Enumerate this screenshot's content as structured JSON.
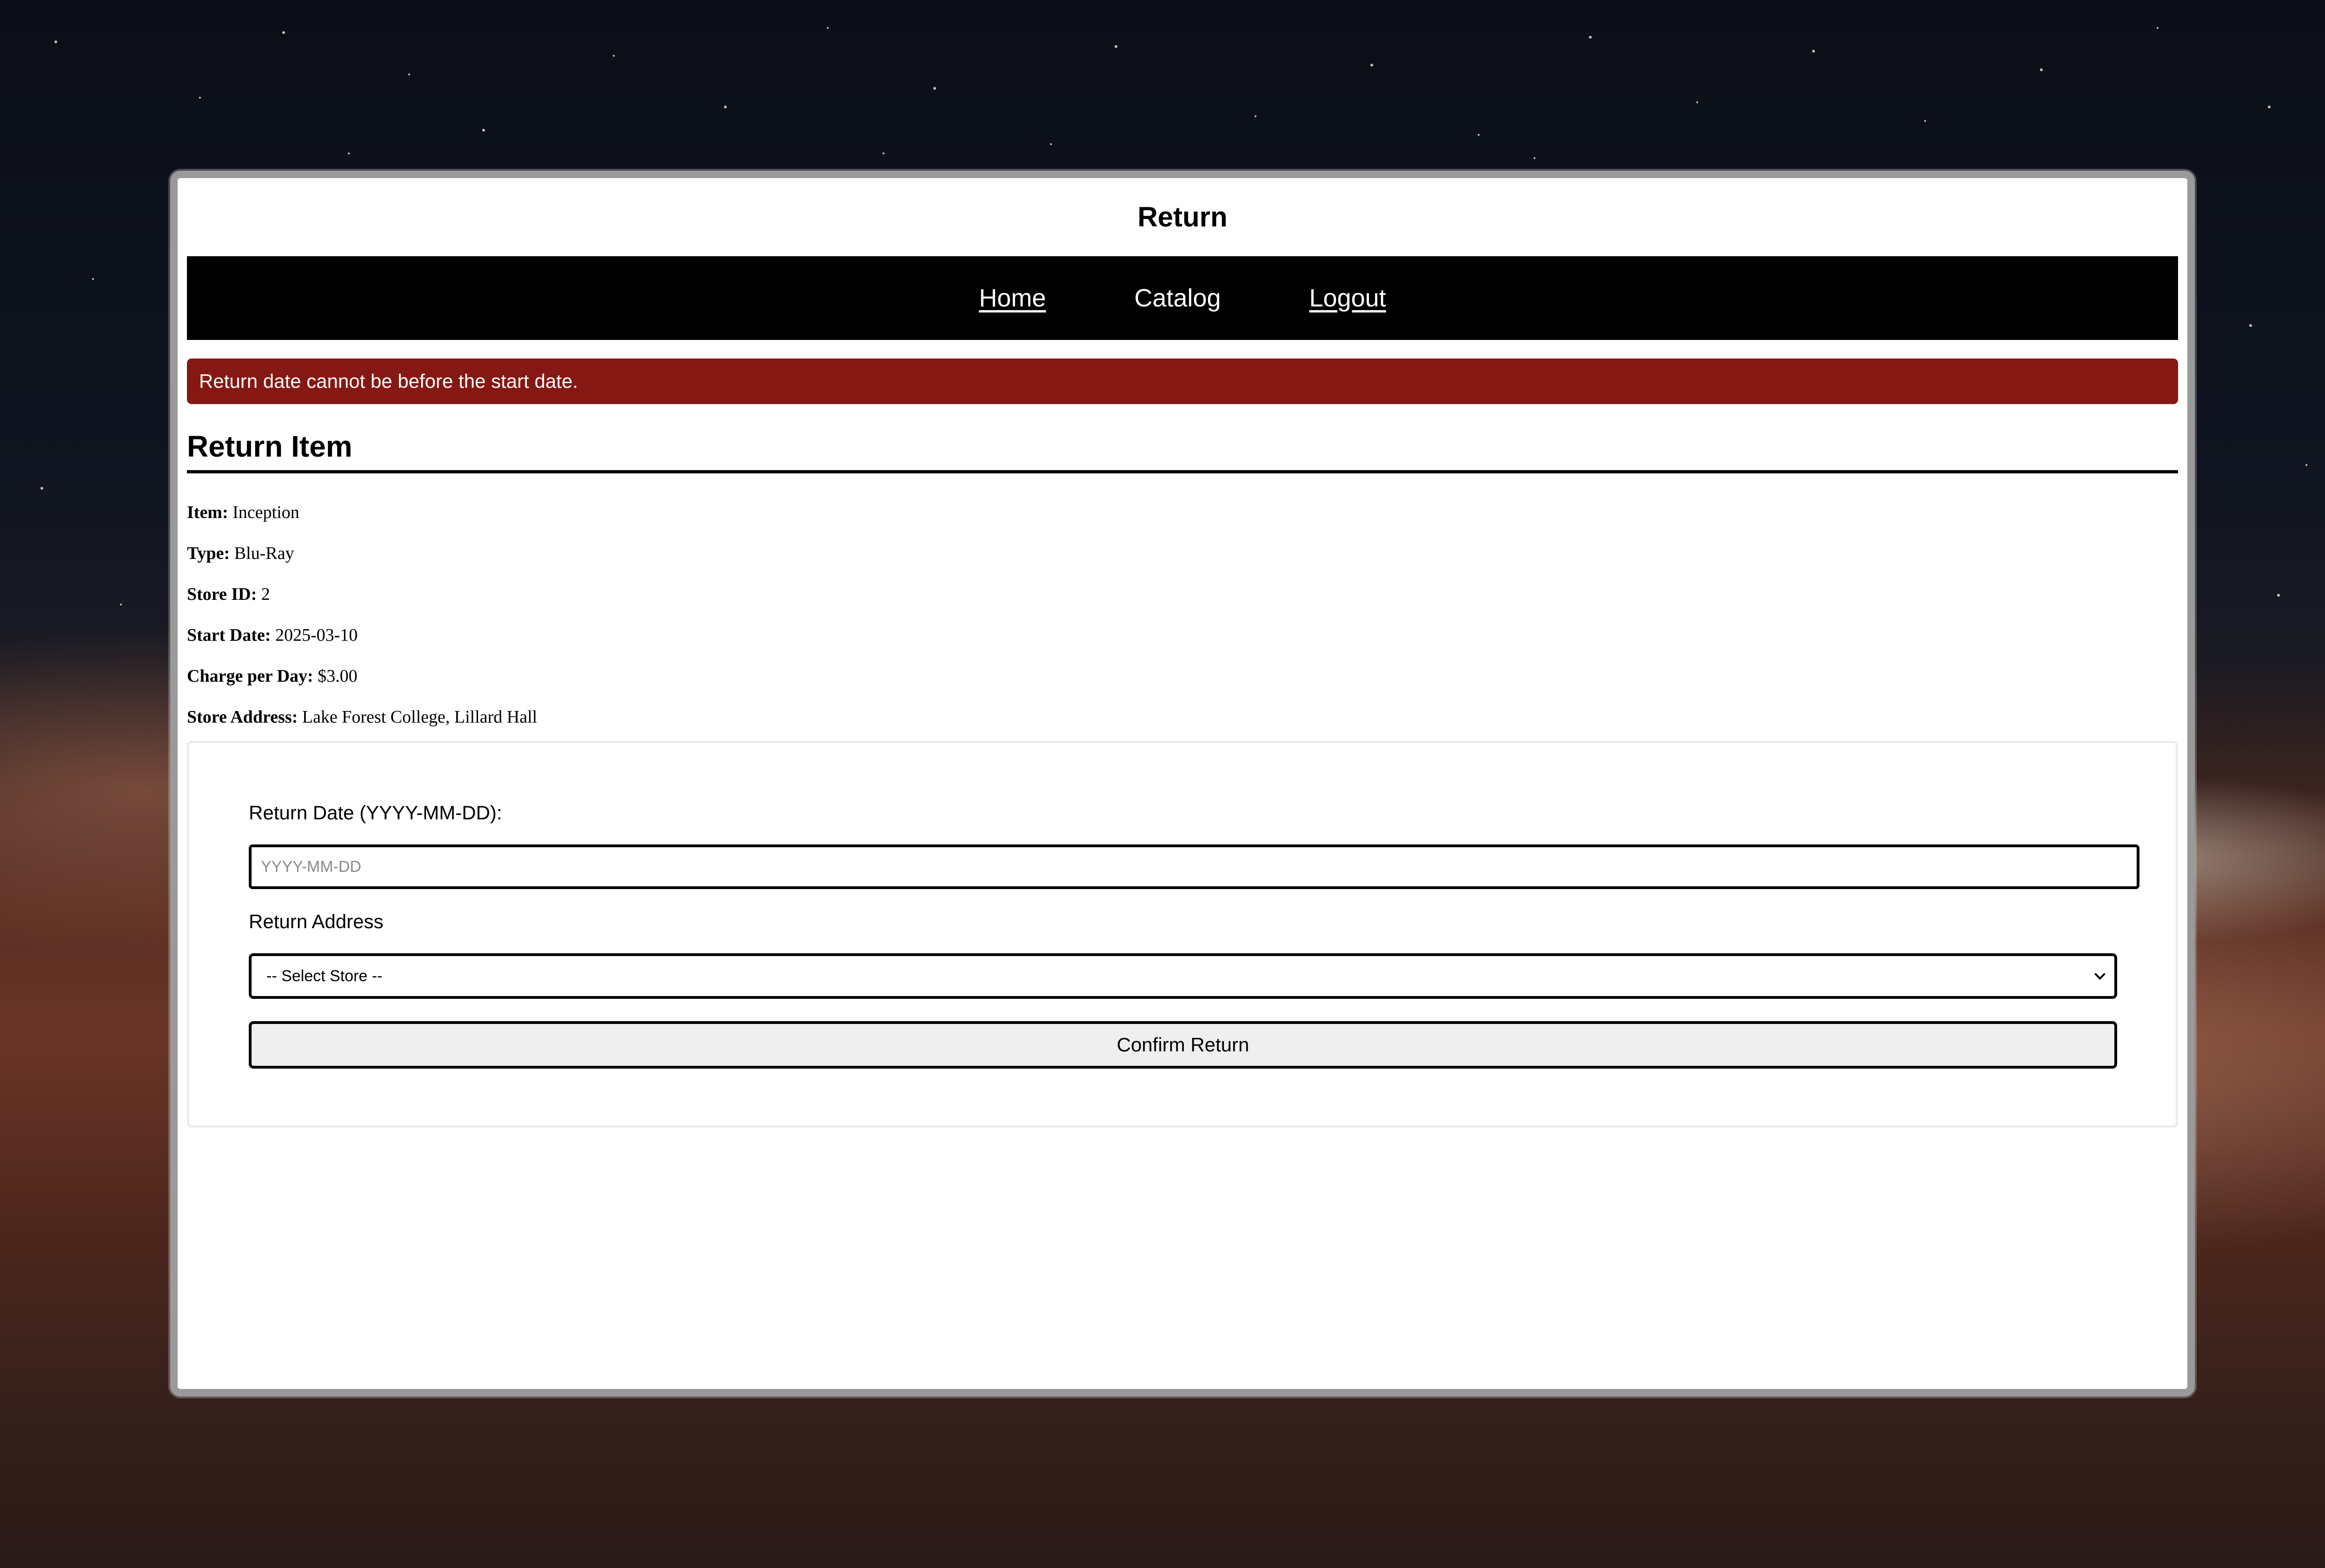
{
  "window": {
    "title": "Return"
  },
  "nav": {
    "items": [
      {
        "label": "Home"
      },
      {
        "label": "Catalog"
      },
      {
        "label": "Logout"
      }
    ]
  },
  "alert": {
    "message": "Return date cannot be before the start date.",
    "color": "#851812"
  },
  "section": {
    "title": "Return Item"
  },
  "item_details": [
    {
      "label": "Item:",
      "value": "Inception"
    },
    {
      "label": "Type:",
      "value": "Blu-Ray"
    },
    {
      "label": "Store ID:",
      "value": "2"
    },
    {
      "label": "Start Date:",
      "value": "2025-03-10"
    },
    {
      "label": "Charge per Day:",
      "value": "$3.00"
    },
    {
      "label": "Store Address:",
      "value": "Lake Forest College, Lillard Hall"
    }
  ],
  "form": {
    "date_label": "Return Date (YYYY-MM-DD):",
    "date_value": "",
    "date_placeholder": "YYYY-MM-DD",
    "address_label": "Return Address",
    "store_select_value": "-- Select Store --",
    "confirm_label": "Confirm Return"
  },
  "icons": {
    "select_arrow": "chevron-down-icon"
  }
}
